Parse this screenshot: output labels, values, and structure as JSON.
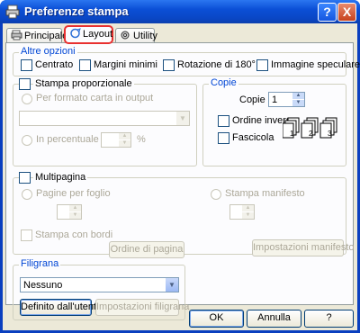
{
  "window": {
    "title": "Preferenze stampa",
    "help_btn": "?",
    "close_btn": "X"
  },
  "tabs": [
    {
      "label": "Principale",
      "active": false
    },
    {
      "label": "Layout",
      "active": true
    },
    {
      "label": "Utility",
      "active": false
    }
  ],
  "altre_opzioni": {
    "title": "Altre opzioni",
    "centrato": "Centrato",
    "margini_minimi": "Margini minimi",
    "rotazione": "Rotazione di 180°",
    "speculare": "Immagine speculare"
  },
  "stampa_proporzionale": {
    "label": "Stampa proporzionale",
    "per_formato": "Per formato carta in output",
    "paper_value": "",
    "in_percentuale": "In percentuale",
    "percent_value": "",
    "percent_unit": "%"
  },
  "copie": {
    "title": "Copie",
    "label": "Copie",
    "value": "1",
    "ordine_inverso": "Ordine inverso",
    "fascicola": "Fascicola",
    "collate_pages": [
      "1",
      "2",
      "3"
    ]
  },
  "multipagina": {
    "label": "Multipagina",
    "pagine_per_foglio": "Pagine per foglio",
    "pagine_value": "",
    "stampa_manifesto": "Stampa manifesto",
    "manifesto_value": "",
    "stampa_con_bordi": "Stampa con bordi",
    "ordine_di_pagina": "Ordine di pagina",
    "impostazioni_manifesto": "Impostazioni manifesto"
  },
  "filigrana": {
    "title": "Filigrana",
    "value": "Nessuno",
    "definito_utente": "Definito dall'utente",
    "impostazioni_filigrana": "Impostazioni filigrana"
  },
  "footer": {
    "ok": "OK",
    "annulla": "Annulla",
    "help": "?"
  }
}
